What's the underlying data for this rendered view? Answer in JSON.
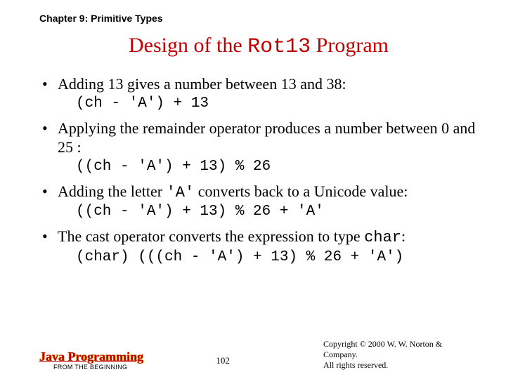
{
  "chapter": "Chapter 9: Primitive Types",
  "title_pre": "Design of the ",
  "title_code": "Rot13",
  "title_post": " Program",
  "bullets": [
    {
      "text": "Adding 13 gives a number between 13 and 38:",
      "code": "(ch - 'A') + 13"
    },
    {
      "text": "Applying the remainder operator produces a number between 0 and 25 :",
      "code": "((ch - 'A') + 13) % 26"
    },
    {
      "text_pre": "Adding the letter ",
      "mono": "'A'",
      "text_post": " converts back to a Unicode value:",
      "code": "((ch - 'A') + 13) % 26 + 'A'"
    },
    {
      "text_pre": "The cast operator converts the expression to type ",
      "mono": "char",
      "text_post": ":",
      "code": "(char) (((ch - 'A') + 13) % 26 + 'A')"
    }
  ],
  "footer": {
    "brand_main": "Java Programming",
    "brand_sub": "FROM THE BEGINNING",
    "page": "102",
    "copyright_l1": "Copyright © 2000 W. W. Norton & Company.",
    "copyright_l2": "All rights reserved."
  }
}
